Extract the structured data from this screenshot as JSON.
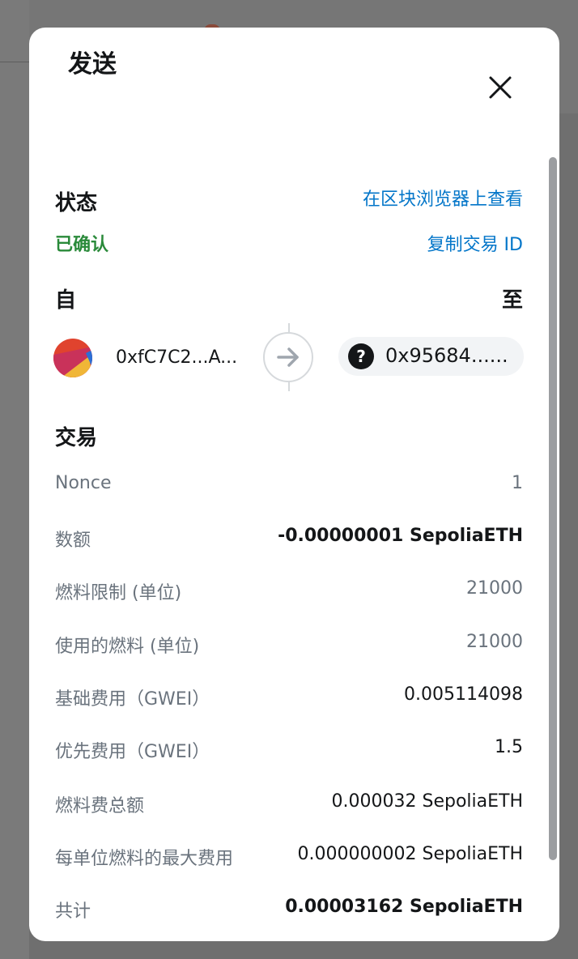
{
  "modal": {
    "title": "发送"
  },
  "status": {
    "label": "状态",
    "value": "已确认",
    "explorer_link": "在区块浏览器上查看",
    "copy_tx_link": "复制交易 ID"
  },
  "parties": {
    "from_label": "自",
    "to_label": "至",
    "from_address": "0xfC7C2...A...",
    "to_address": "0x95684......",
    "to_icon_glyph": "?"
  },
  "transaction": {
    "label": "交易",
    "rows": [
      {
        "label": "Nonce",
        "value": "1"
      },
      {
        "label": "数额",
        "value": "-0.00000001 SepoliaETH"
      },
      {
        "label": "燃料限制 (单位)",
        "value": "21000"
      },
      {
        "label": "使用的燃料 (单位)",
        "value": "21000"
      },
      {
        "label": "基础费用（GWEI）",
        "value": "0.005114098"
      },
      {
        "label": "优先费用（GWEI）",
        "value": "1.5"
      },
      {
        "label": "燃料费总额",
        "value": "0.000032 SepoliaETH"
      },
      {
        "label": "每单位燃料的最大费用",
        "value": "0.000000002 SepoliaETH"
      },
      {
        "label": "共计",
        "value": "0.00003162 SepoliaETH"
      }
    ]
  },
  "colors": {
    "link": "#0376c9",
    "confirmed": "#2a8a3a",
    "text_primary": "#141618",
    "text_secondary": "#6a737d"
  }
}
